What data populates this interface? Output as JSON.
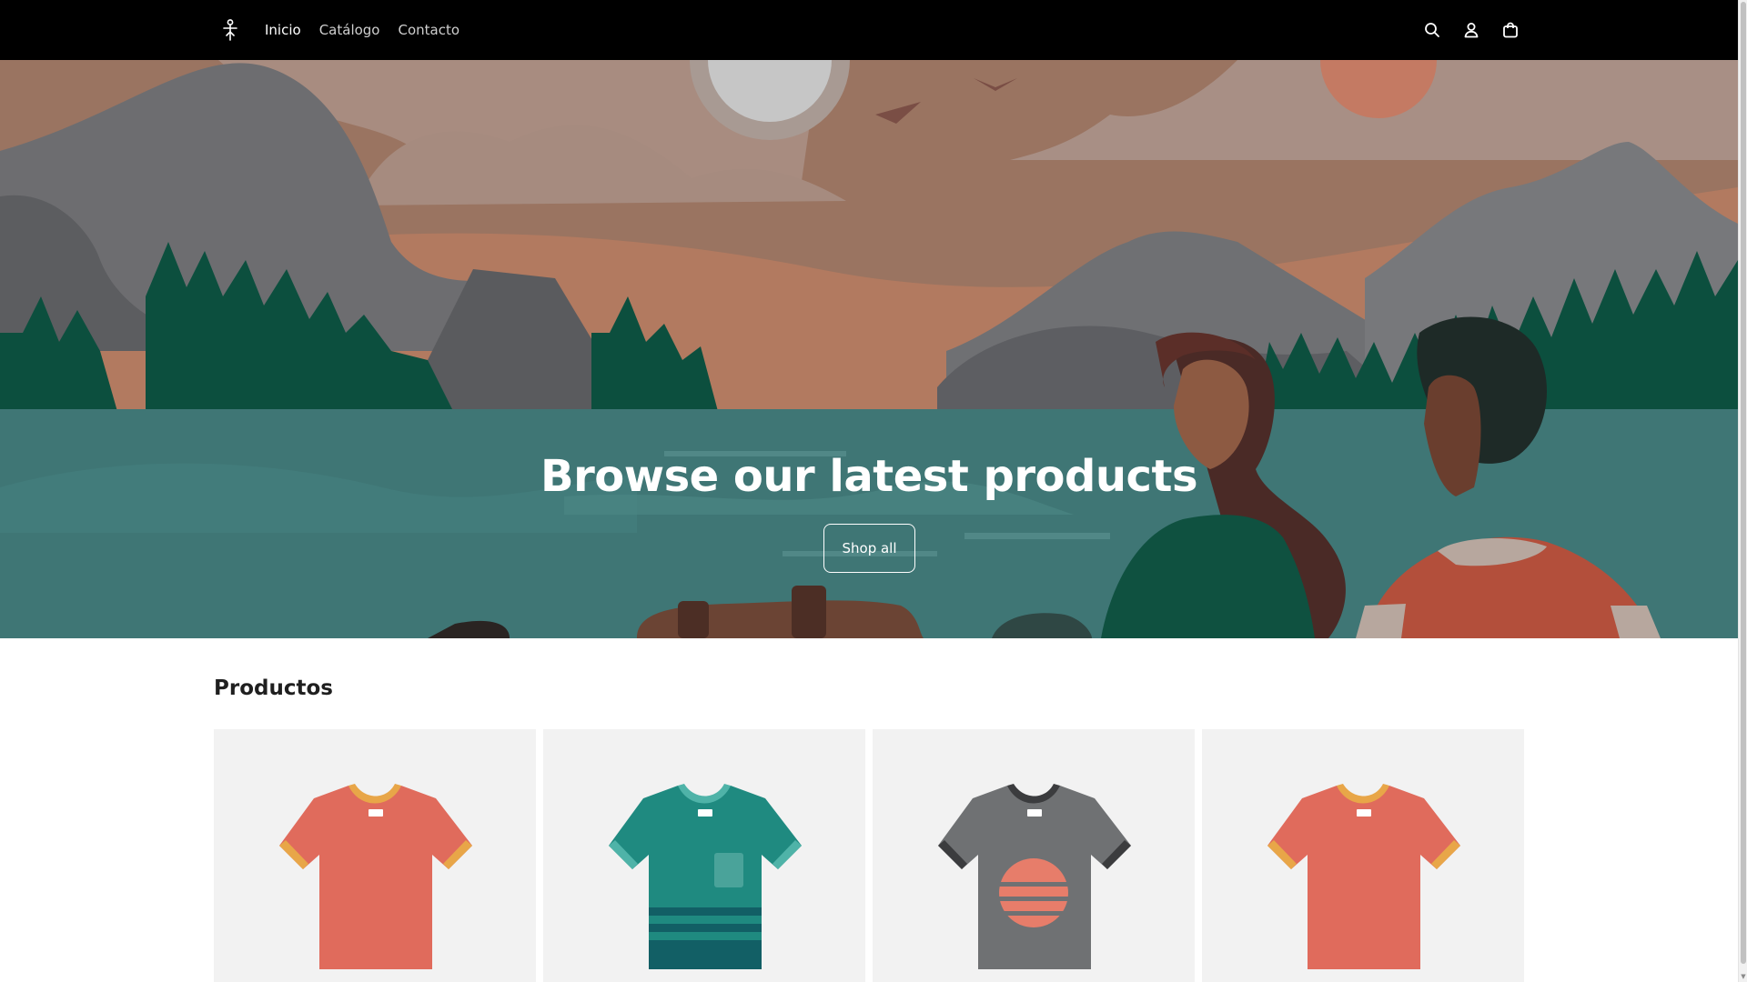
{
  "header": {
    "logo_icon": "figure-logo-icon",
    "nav": [
      {
        "label": "Inicio",
        "active": true
      },
      {
        "label": "Catálogo",
        "active": false
      },
      {
        "label": "Contacto",
        "active": false
      }
    ],
    "icons": [
      "search-icon",
      "account-icon",
      "cart-icon"
    ]
  },
  "hero": {
    "title": "Browse our latest products",
    "button_label": "Shop all"
  },
  "products": {
    "title": "Productos",
    "items": [
      {
        "image": "coral-tshirt-icon",
        "color": "#e06b5c"
      },
      {
        "image": "teal-striped-tshirt-icon",
        "color": "#1f8a80"
      },
      {
        "image": "grey-sunset-tshirt-icon",
        "color": "#6f7173"
      },
      {
        "image": "coral-tshirt-icon",
        "color": "#e06b5c"
      }
    ]
  },
  "colors": {
    "header_bg": "#000000",
    "card_bg": "#f2f2f2",
    "water": "#3f7675",
    "sky": "#9a7461"
  }
}
